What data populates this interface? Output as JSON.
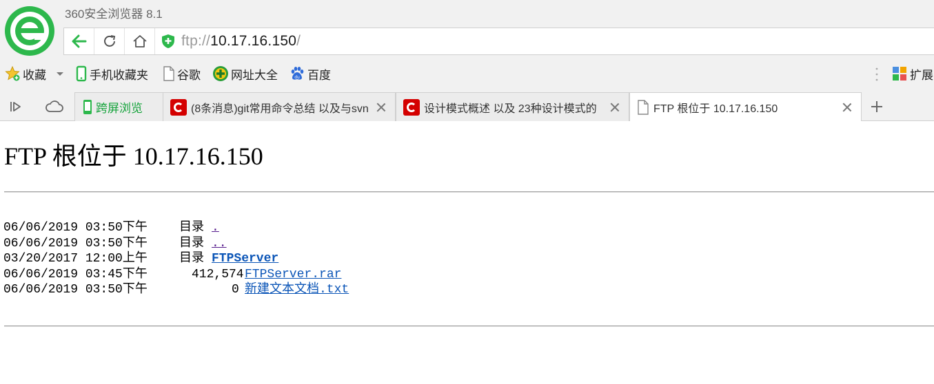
{
  "browser": {
    "app_title": "360安全浏览器 8.1",
    "address": {
      "scheme": "ftp://",
      "host": "10.17.16.150",
      "trailing": "/"
    },
    "bookmarks": [
      {
        "label": "收藏",
        "icon": "star-icon"
      },
      {
        "label": "手机收藏夹",
        "icon": "phone-icon"
      },
      {
        "label": "谷歌",
        "icon": "page-icon"
      },
      {
        "label": "网址大全",
        "icon": "nav-plus-icon"
      },
      {
        "label": "百度",
        "icon": "baidu-paw-icon"
      }
    ],
    "extensions_label": "扩展",
    "tabs": [
      {
        "label": "跨屏浏览",
        "icon": "phone-icon",
        "active": false
      },
      {
        "label": "(8条消息)git常用命令总结 以及与svn",
        "icon": "csdn-icon",
        "active": false
      },
      {
        "label": "设计模式概述 以及 23种设计模式的",
        "icon": "csdn-icon",
        "active": false
      },
      {
        "label": "FTP 根位于 10.17.16.150",
        "icon": "page-icon",
        "active": true
      }
    ],
    "colors": {
      "accent_green": "#2db84c",
      "csdn_red": "#d40000",
      "link_blue": "#0b55b7",
      "visited_purple": "#551a8b"
    }
  },
  "page": {
    "title": "FTP 根位于 10.17.16.150",
    "entries": [
      {
        "date": "06/06/2019 03:50下午",
        "kind": "目录",
        "size": "",
        "name": ".",
        "visited": true,
        "bold": false
      },
      {
        "date": "06/06/2019 03:50下午",
        "kind": "目录",
        "size": "",
        "name": "..",
        "visited": true,
        "bold": false
      },
      {
        "date": "03/20/2017 12:00上午",
        "kind": "目录",
        "size": "",
        "name": "FTPServer",
        "visited": false,
        "bold": true
      },
      {
        "date": "06/06/2019 03:45下午",
        "kind": "",
        "size": "412,574",
        "name": "FTPServer.rar",
        "visited": false,
        "bold": false
      },
      {
        "date": "06/06/2019 03:50下午",
        "kind": "",
        "size": "0",
        "name": "新建文本文档.txt",
        "visited": false,
        "bold": false
      }
    ]
  }
}
